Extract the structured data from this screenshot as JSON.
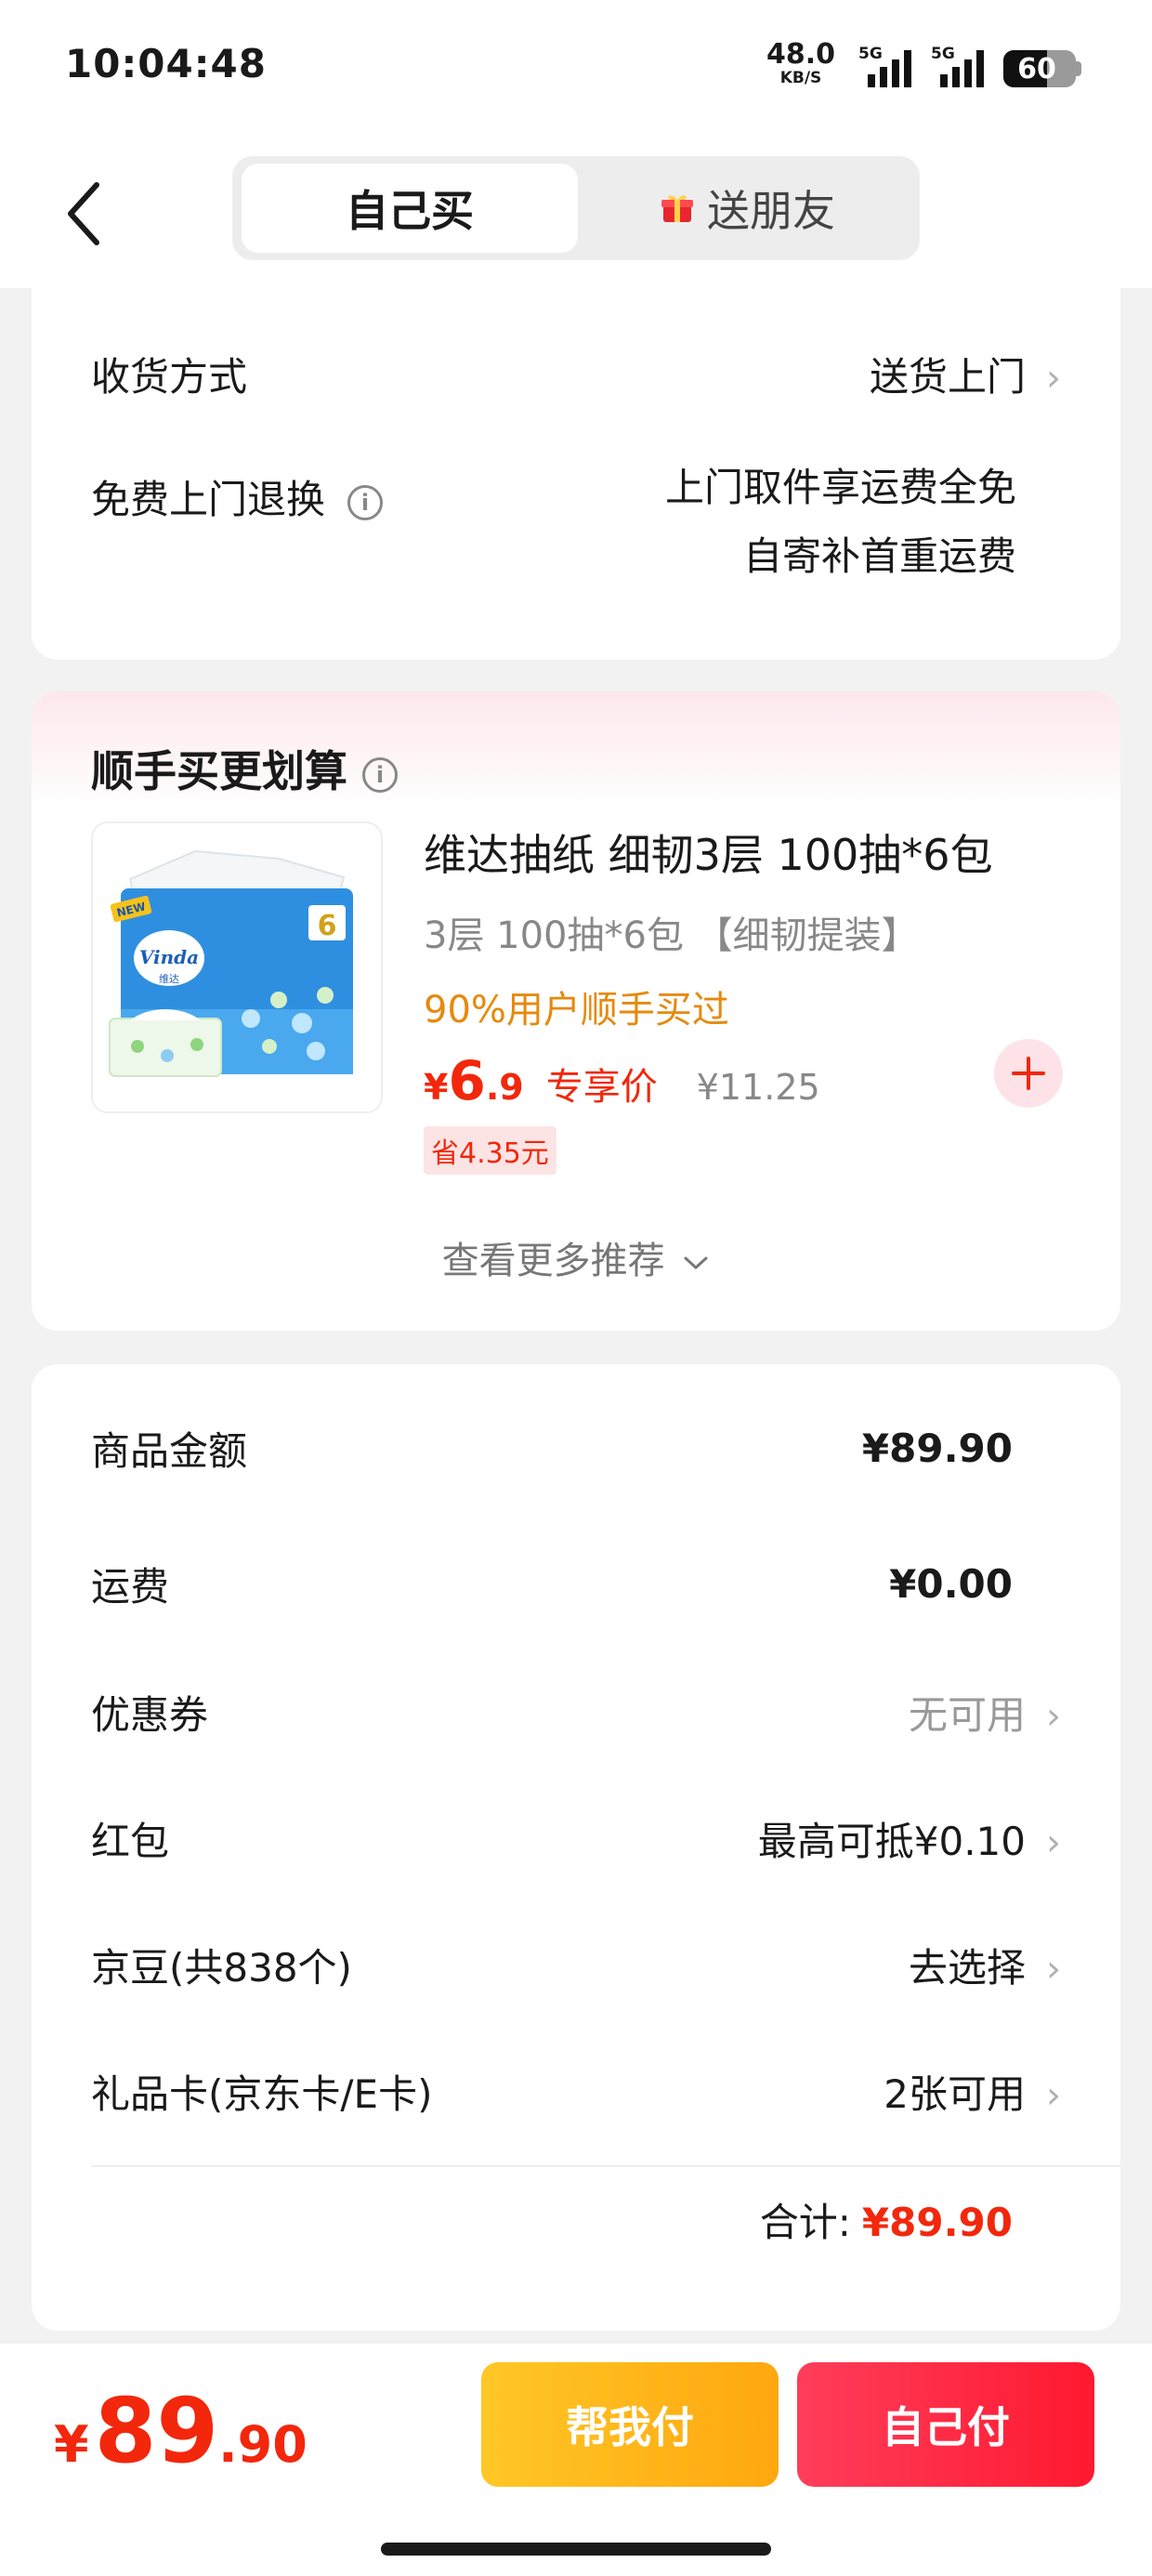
{
  "status_bar": {
    "time": "10:04:48",
    "net_speed_value": "48.0",
    "net_speed_unit": "KB/S",
    "sim1_label": "5G",
    "sim2_label": "5G",
    "battery": "60"
  },
  "header": {
    "tab_self": "自己买",
    "tab_gift": "送朋友"
  },
  "delivery": {
    "method_label": "收货方式",
    "method_value": "送货上门",
    "return_label": "免费上门退换",
    "return_value_line1": "上门取件享运费全免",
    "return_value_line2": "自寄补首重运费"
  },
  "upsell": {
    "title": "顺手买更划算",
    "product": {
      "name": "维达抽纸 细韧3层 100抽*6包",
      "spec": "3层 100抽*6包 【细韧提装】",
      "social": "90%用户顺手买过",
      "price_symbol": "¥",
      "price_int": "6",
      "price_dec": ".9",
      "price_tag": "专享价",
      "orig_price": "¥11.25",
      "save": "省4.35元",
      "image_brand": "Vinda",
      "image_brand_cn": "维达",
      "image_badge": "6",
      "image_new": "NEW"
    },
    "more": "查看更多推荐"
  },
  "summary": {
    "goods_label": "商品金额",
    "goods_value": "¥89.90",
    "shipping_label": "运费",
    "shipping_value": "¥0.00",
    "coupon_label": "优惠券",
    "coupon_value": "无可用",
    "redpack_label": "红包",
    "redpack_value": "最高可抵¥0.10",
    "jd_beans_label": "京豆(共838个)",
    "jd_beans_value": "去选择",
    "giftcard_label": "礼品卡(京东卡/E卡)",
    "giftcard_value": "2张可用",
    "total_label": "合计:",
    "total_value": "¥89.90"
  },
  "bottom": {
    "price_symbol": "¥",
    "price_int": "89",
    "price_dec": ".90",
    "help_pay": "帮我付",
    "self_pay": "自己付"
  },
  "colors": {
    "accent_red": "#f2270c",
    "orange": "#e58a0e",
    "yellow_btn": "#ffb81c",
    "red_btn": "#ff2540"
  }
}
